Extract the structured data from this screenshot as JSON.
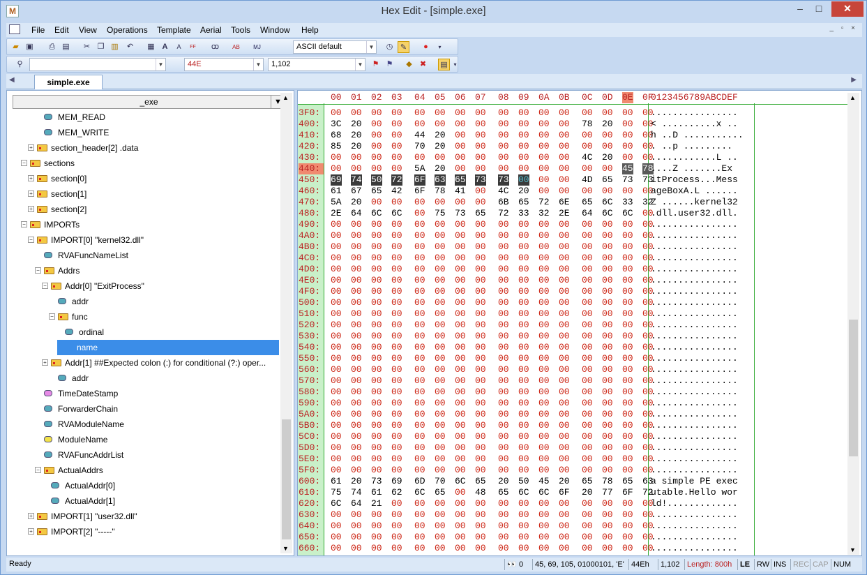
{
  "window": {
    "title": "Hex Edit - [simple.exe]",
    "min": "–",
    "max": "□",
    "close": "✕"
  },
  "menu": [
    "File",
    "Edit",
    "View",
    "Operations",
    "Template",
    "Aerial",
    "Tools",
    "Window",
    "Help"
  ],
  "mdi_controls": "_ ▫ ×",
  "toolbar": {
    "charset_select": "ASCII default",
    "icons": [
      "open-icon",
      "save-icon",
      "print-icon",
      "print-preview-icon",
      "cut-icon",
      "copy-icon",
      "paste-icon",
      "undo-icon",
      "calculator-icon",
      "font-increase-icon",
      "font-decrease-icon",
      "char-set-icon",
      "bookmark-icon",
      "search-replace-icon",
      "mark-icon",
      "timer-icon",
      "highlight-icon",
      "record-macro-icon"
    ]
  },
  "toolbar2": {
    "find_value": "",
    "hex_address": "44E",
    "dec_address": "1,102"
  },
  "tabs": {
    "active": "simple.exe"
  },
  "tree": {
    "root_select": "_exe",
    "nodes": [
      {
        "label": "MEM_READ"
      },
      {
        "label": "MEM_WRITE"
      },
      {
        "label": "section_header[2]  .data"
      },
      {
        "label": "sections"
      },
      {
        "label": "section[0]"
      },
      {
        "label": "section[1]"
      },
      {
        "label": "section[2]"
      },
      {
        "label": "IMPORTs"
      },
      {
        "label": "IMPORT[0]  \"kernel32.dll\""
      },
      {
        "label": "RVAFuncNameList"
      },
      {
        "label": "Addrs"
      },
      {
        "label": "Addr[0]  \"ExitProcess\""
      },
      {
        "label": "addr"
      },
      {
        "label": "func"
      },
      {
        "label": "ordinal"
      },
      {
        "label": "name"
      },
      {
        "label": "Addr[1]  ##Expected colon (:) for conditional (?:) oper..."
      },
      {
        "label": "addr"
      },
      {
        "label": "TimeDateStamp"
      },
      {
        "label": "ForwarderChain"
      },
      {
        "label": "RVAModuleName"
      },
      {
        "label": "ModuleName"
      },
      {
        "label": "RVAFuncAddrList"
      },
      {
        "label": "ActualAddrs"
      },
      {
        "label": "ActualAddr[0]"
      },
      {
        "label": "ActualAddr[1]"
      },
      {
        "label": "IMPORT[1]  \"user32.dll\""
      },
      {
        "label": "IMPORT[2]  \"-----\""
      }
    ]
  },
  "hex": {
    "columns": [
      "00",
      "01",
      "02",
      "03",
      "04",
      "05",
      "06",
      "07",
      "08",
      "09",
      "0A",
      "0B",
      "0C",
      "0D",
      "0E",
      "0F"
    ],
    "ascii_header": "0123456789ABCDEF",
    "rows": [
      {
        "addr": "3F0:",
        "bytes": "00 00 00 00 00 00 00 00 00 00 00 00 00 00 00 00",
        "ascii": "................"
      },
      {
        "addr": "400:",
        "bytes": "3C 20 00 00 00 00 00 00 00 00 00 00 78 20 00 00",
        "ascii": "< ..........x .."
      },
      {
        "addr": "410:",
        "bytes": "68 20 00 00 44 20 00 00 00 00 00 00 00 00 00 00",
        "ascii": "h ..D ..........."
      },
      {
        "addr": "420:",
        "bytes": "85 20 00 00 70 20 00 00 00 00 00 00 00 00 00 00",
        "ascii": ". ..p ........."
      },
      {
        "addr": "430:",
        "bytes": "00 00 00 00 00 00 00 00 00 00 00 00 4C 20 00 00",
        "ascii": "............L .."
      },
      {
        "addr": "440:",
        "bytes": "00 00 00 00 5A 20 00 00 00 00 00 00 00 00 45 78",
        "ascii": "....Z .......Ex"
      },
      {
        "addr": "450:",
        "bytes": "69 74 50 72 6F 63 65 73 73 00 00 00 4D 65 73 73",
        "ascii": "itProcess...Mess"
      },
      {
        "addr": "460:",
        "bytes": "61 67 65 42 6F 78 41 00 4C 20 00 00 00 00 00 00",
        "ascii": "ageBoxA.L ......"
      },
      {
        "addr": "470:",
        "bytes": "5A 20 00 00 00 00 00 00 6B 65 72 6E 65 6C 33 32",
        "ascii": "Z ......kernel32"
      },
      {
        "addr": "480:",
        "bytes": "2E 64 6C 6C 00 75 73 65 72 33 32 2E 64 6C 6C 00",
        "ascii": ".dll.user32.dll."
      },
      {
        "addr": "490:",
        "bytes": "00 00 00 00 00 00 00 00 00 00 00 00 00 00 00 00",
        "ascii": "................"
      },
      {
        "addr": "4A0:",
        "bytes": "00 00 00 00 00 00 00 00 00 00 00 00 00 00 00 00",
        "ascii": "................"
      },
      {
        "addr": "4B0:",
        "bytes": "00 00 00 00 00 00 00 00 00 00 00 00 00 00 00 00",
        "ascii": "................"
      },
      {
        "addr": "4C0:",
        "bytes": "00 00 00 00 00 00 00 00 00 00 00 00 00 00 00 00",
        "ascii": "................"
      },
      {
        "addr": "4D0:",
        "bytes": "00 00 00 00 00 00 00 00 00 00 00 00 00 00 00 00",
        "ascii": "................"
      },
      {
        "addr": "4E0:",
        "bytes": "00 00 00 00 00 00 00 00 00 00 00 00 00 00 00 00",
        "ascii": "................"
      },
      {
        "addr": "4F0:",
        "bytes": "00 00 00 00 00 00 00 00 00 00 00 00 00 00 00 00",
        "ascii": "................"
      },
      {
        "addr": "500:",
        "bytes": "00 00 00 00 00 00 00 00 00 00 00 00 00 00 00 00",
        "ascii": "................"
      },
      {
        "addr": "510:",
        "bytes": "00 00 00 00 00 00 00 00 00 00 00 00 00 00 00 00",
        "ascii": "................"
      },
      {
        "addr": "520:",
        "bytes": "00 00 00 00 00 00 00 00 00 00 00 00 00 00 00 00",
        "ascii": "................"
      },
      {
        "addr": "530:",
        "bytes": "00 00 00 00 00 00 00 00 00 00 00 00 00 00 00 00",
        "ascii": "................"
      },
      {
        "addr": "540:",
        "bytes": "00 00 00 00 00 00 00 00 00 00 00 00 00 00 00 00",
        "ascii": "................"
      },
      {
        "addr": "550:",
        "bytes": "00 00 00 00 00 00 00 00 00 00 00 00 00 00 00 00",
        "ascii": "................"
      },
      {
        "addr": "560:",
        "bytes": "00 00 00 00 00 00 00 00 00 00 00 00 00 00 00 00",
        "ascii": "................"
      },
      {
        "addr": "570:",
        "bytes": "00 00 00 00 00 00 00 00 00 00 00 00 00 00 00 00",
        "ascii": "................"
      },
      {
        "addr": "580:",
        "bytes": "00 00 00 00 00 00 00 00 00 00 00 00 00 00 00 00",
        "ascii": "................"
      },
      {
        "addr": "590:",
        "bytes": "00 00 00 00 00 00 00 00 00 00 00 00 00 00 00 00",
        "ascii": "................"
      },
      {
        "addr": "5A0:",
        "bytes": "00 00 00 00 00 00 00 00 00 00 00 00 00 00 00 00",
        "ascii": "................"
      },
      {
        "addr": "5B0:",
        "bytes": "00 00 00 00 00 00 00 00 00 00 00 00 00 00 00 00",
        "ascii": "................"
      },
      {
        "addr": "5C0:",
        "bytes": "00 00 00 00 00 00 00 00 00 00 00 00 00 00 00 00",
        "ascii": "................"
      },
      {
        "addr": "5D0:",
        "bytes": "00 00 00 00 00 00 00 00 00 00 00 00 00 00 00 00",
        "ascii": "................"
      },
      {
        "addr": "5E0:",
        "bytes": "00 00 00 00 00 00 00 00 00 00 00 00 00 00 00 00",
        "ascii": "................"
      },
      {
        "addr": "5F0:",
        "bytes": "00 00 00 00 00 00 00 00 00 00 00 00 00 00 00 00",
        "ascii": "................"
      },
      {
        "addr": "600:",
        "bytes": "61 20 73 69 6D 70 6C 65 20 50 45 20 65 78 65 63",
        "ascii": "a simple PE exec"
      },
      {
        "addr": "610:",
        "bytes": "75 74 61 62 6C 65 00 48 65 6C 6C 6F 20 77 6F 72",
        "ascii": "utable.Hello wor"
      },
      {
        "addr": "620:",
        "bytes": "6C 64 21 00 00 00 00 00 00 00 00 00 00 00 00 00",
        "ascii": "ld!............."
      },
      {
        "addr": "630:",
        "bytes": "00 00 00 00 00 00 00 00 00 00 00 00 00 00 00 00",
        "ascii": "................"
      },
      {
        "addr": "640:",
        "bytes": "00 00 00 00 00 00 00 00 00 00 00 00 00 00 00 00",
        "ascii": "................"
      },
      {
        "addr": "650:",
        "bytes": "00 00 00 00 00 00 00 00 00 00 00 00 00 00 00 00",
        "ascii": "................"
      },
      {
        "addr": "660:",
        "bytes": "00 00 00 00 00 00 00 00 00 00 00 00 00 00 00 00",
        "ascii": "................"
      }
    ]
  },
  "status": {
    "ready": "Ready",
    "search_count": "0",
    "value": "45, 69, 105, 01000101, 'E'",
    "hex_addr": "44Eh",
    "dec_addr": "1,102",
    "length": "Length: 800h",
    "endian": "LE",
    "rw": "RW",
    "ins": "INS",
    "rec": "REC",
    "cap": "CAP",
    "num": "NUM"
  }
}
